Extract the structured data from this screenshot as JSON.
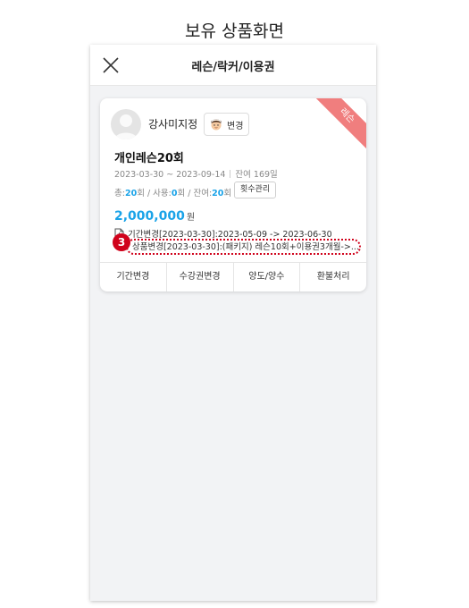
{
  "page_heading": "보유 상품화면",
  "header": {
    "title": "레슨/락커/이용권"
  },
  "card": {
    "ribbon": "레슨",
    "instructor_name": "강사미지정",
    "change_label": "변경",
    "product_name": "개인레슨20회",
    "period": "2023-03-30 ~ 2023-09-14",
    "remaining_days": "잔여 169일",
    "count_total_label": "총:",
    "count_total": "20",
    "count_used_label": "회 / 사용:",
    "count_used": "0",
    "count_remain_label": "회 / 잔여:",
    "count_remain": "20",
    "count_unit": "회",
    "count_manage_label": "횟수관리",
    "price": "2,000,000",
    "price_unit": "원",
    "history_period": "기간변경[2023-03-30]:2023-05-09 -> 2023-06-30",
    "history_product": "상품변경[2023-03-30]:(패키지) 레슨10회+이용권3개월->...",
    "callout_number": "3",
    "actions": [
      "기간변경",
      "수강권변경",
      "양도/양수",
      "환불처리"
    ]
  },
  "colors": {
    "accent": "#1aa3e8",
    "ribbon": "#f07e7e",
    "callout": "#d0021b"
  },
  "icons": {
    "close": "close-icon",
    "avatar": "avatar-placeholder-icon",
    "face": "face-icon",
    "history": "document-icon"
  }
}
